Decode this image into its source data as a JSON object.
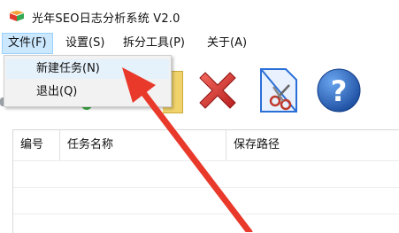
{
  "window": {
    "title": "光年SEO日志分析系统 V2.0",
    "icon": "app-logo-icon"
  },
  "menubar": {
    "items": [
      {
        "label": "文件(F)",
        "active": true
      },
      {
        "label": "设置(S)"
      },
      {
        "label": "拆分工具(P)"
      },
      {
        "label": "关于(A)"
      }
    ]
  },
  "file_menu": {
    "items": [
      {
        "label": "新建任务(N)",
        "hover": true
      },
      {
        "label": "退出(Q)"
      }
    ]
  },
  "toolbar": {
    "buttons": [
      {
        "icon": "delete-x-icon",
        "color": "#d92b2b"
      },
      {
        "icon": "file-split-scissors-icon",
        "color": "#2a6fd6"
      },
      {
        "icon": "help-question-icon",
        "color": "#1f5fb8"
      }
    ]
  },
  "table": {
    "columns": [
      "编号",
      "任务名称",
      "保存路径"
    ]
  },
  "annotation": {
    "arrow_color": "#e8392b"
  }
}
